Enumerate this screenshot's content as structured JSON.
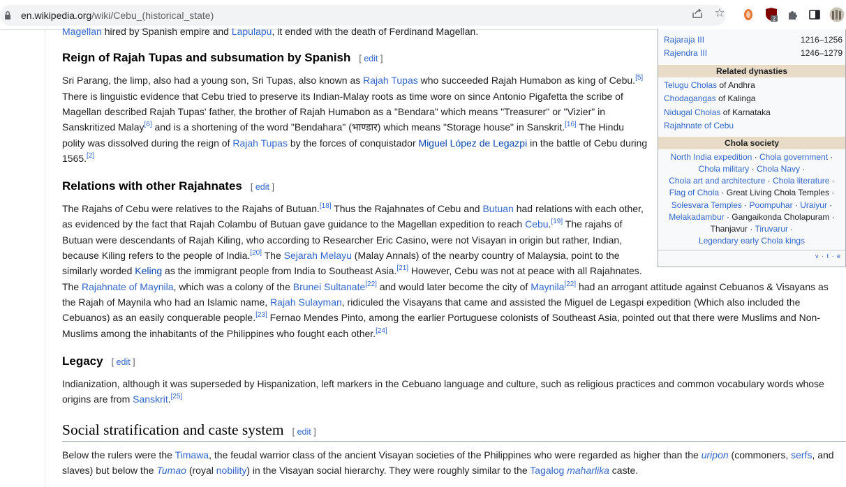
{
  "browser": {
    "url_host": "en.wikipedia.org",
    "url_path": "/wiki/Cebu_(historical_state)",
    "icons": [
      "lock-icon",
      "share-icon",
      "star-icon",
      "extension-icon",
      "ublock-icon",
      "puzzle-icon",
      "sidepanel-icon",
      "profile-avatar"
    ],
    "ublock_badge": "2"
  },
  "infobox": {
    "rulers": [
      {
        "name": "Rajaraja III",
        "years": "1216–1256"
      },
      {
        "name": "Rajendra III",
        "years": "1246–1279"
      }
    ],
    "related_title": "Related dynasties",
    "related": [
      {
        "link": "Telugu Cholas",
        "rest": " of Andhra"
      },
      {
        "link": "Chodagangas",
        "rest": " of Kalinga"
      },
      {
        "link": "Nidugal Cholas",
        "rest": " of Karnataka"
      },
      {
        "link": "Rajahnate of Cebu",
        "rest": ""
      }
    ],
    "society_title": "Chola society",
    "society_lines": [
      [
        "North India expedition",
        "Chola government"
      ],
      [
        "Chola military",
        "Chola Navy"
      ],
      [
        "Chola art and architecture",
        "Chola literature"
      ],
      [
        "Flag of Chola",
        "Great Living Chola Temples"
      ],
      [
        "Solesvara Temples",
        "Poompuhar",
        "Uraiyur"
      ],
      [
        "Melakadambur",
        "Gangaikonda Cholapuram"
      ],
      [
        "Thanjavur",
        "Tiruvarur"
      ],
      [
        "Legendary early Chola kings"
      ]
    ],
    "vte": "v · t · e"
  },
  "top_partial": {
    "a": "Magellan",
    "b": " hired by Spanish empire and ",
    "c": "Lapulapu",
    "d": ", it ended with the death of Ferdinand Magellan."
  },
  "sections": {
    "reign": {
      "title": "Reign of Rajah Tupas and subsumation by Spanish",
      "edit": "edit"
    },
    "relations": {
      "title": "Relations with other Rajahnates",
      "edit": "edit"
    },
    "legacy": {
      "title": "Legacy",
      "edit": "edit"
    },
    "social": {
      "title": "Social stratification and caste system",
      "edit": "edit"
    }
  },
  "reign_text": {
    "l1a": "Sri Parang, the limp, also had a young son, Sri Tupas, also known as ",
    "l1b": "Rajah Tupas",
    "l1c": " who succeeded Rajah Humabon as king of Cebu.",
    "l1s": "[5]",
    "l2": "There is linguistic evidence that Cebu tried to preserve its Indian-Malay roots as time wore on since Antonio Pigafetta the scribe of",
    "l3": "Magellan described Rajah Tupas' father, the brother of Rajah Humabon as a \"Bendara\" which means \"Treasurer\" or \"Vizier\" in",
    "l4a": "Sanskritized Malay",
    "l4s1": "[6]",
    "l4b": " and is a shortening of the word \"Bendahara\" (भाण्डार) which means \"Storage house\" in Sanskrit.",
    "l4s2": "[16]",
    "l4c": " The Hindu",
    "l5a": "polity was dissolved during the reign of ",
    "l5b": "Rajah Tupas",
    "l5c": " by the forces of conquistador ",
    "l5d": "Miguel López de Legazpi",
    "l5e": " in the battle of Cebu during",
    "l6a": "1565.",
    "l6s": "[2]"
  },
  "relations_text": {
    "l1a": "The Rajahs of Cebu were relatives to the Rajahs of Butuan.",
    "l1s": "[18]",
    "l1b": " Thus the Rajahnates of Cebu and ",
    "l1c": "Butuan",
    "l1d": " had relations with each other,",
    "l2a": "as evidenced by the fact that Rajah Colambu of Butuan gave guidance to the Magellan expedition to reach ",
    "l2b": "Cebu",
    "l2c": ".",
    "l2s": "[19]",
    "l2d": " The rajahs of",
    "l3": "Butuan were descendants of Rajah Kiling, who according to Researcher Eric Casino, were not Visayan in origin but rather, Indian,",
    "l4a": "because Kiling refers to the people of India.",
    "l4s": "[20]",
    "l4b": " The ",
    "l4c": "Sejarah Melayu",
    "l4d": " (Malay Annals) of the nearby country of Malaysia, point to the",
    "l5a": "similarly worded ",
    "l5b": "Keling",
    "l5c": " as the immigrant people from India to Southeast Asia.",
    "l5s": "[21]",
    "l5d": " However, Cebu was not at peace with all Rajahnates.",
    "l6a": "The ",
    "l6b": "Rajahnate of Maynila",
    "l6c": ", which was a colony of the ",
    "l6d": "Brunei Sultanate",
    "l6s1": "[22]",
    "l6e": " and would later become the city of ",
    "l6f": "Maynila",
    "l6s2": "[22]",
    "l6g": " had an arrogant attitude against Cebuanos & Visayans as",
    "l7a": "the Rajah of Maynila who had an Islamic name, ",
    "l7b": "Rajah Sulayman",
    "l7c": ", ridiculed the Visayans that came and assisted the Miguel de Legaspi expedition (Which also included the",
    "l8a": "Cebuanos) as an easily conquerable people.",
    "l8s": "[23]",
    "l8b": " Fernao Mendes Pinto, among the earlier Portuguese colonists of Southeast Asia, pointed out that there were Muslims and Non-",
    "l9a": "Muslims among the inhabitants of the Philippines who fought each other.",
    "l9s": "[24]"
  },
  "legacy_text": {
    "l1": "Indianization, although it was superseded by Hispanization, left markers in the Cebuano language and culture, such as religious practices and common vocabulary words whose",
    "l2a": "origins are from ",
    "l2b": "Sanskrit",
    "l2c": ".",
    "l2s": "[25]"
  },
  "social_text": {
    "l1a": "Below the rulers were the ",
    "l1b": "Timawa",
    "l1c": ", the feudal warrior class of the ancient Visayan societies of the Philippines who were regarded as higher than the ",
    "l1d": "uripon",
    "l1e": " (commoners, ",
    "l1f": "serfs",
    "l1g": ", and",
    "l2a": "slaves) but below the ",
    "l2b": "Tumao",
    "l2c": " (royal ",
    "l2d": "nobility",
    "l2e": ") in the Visayan social hierarchy. They were roughly similar to the ",
    "l2f": "Tagalog",
    "l2g": " ",
    "l2h": "maharlika",
    "l2i": " caste."
  }
}
